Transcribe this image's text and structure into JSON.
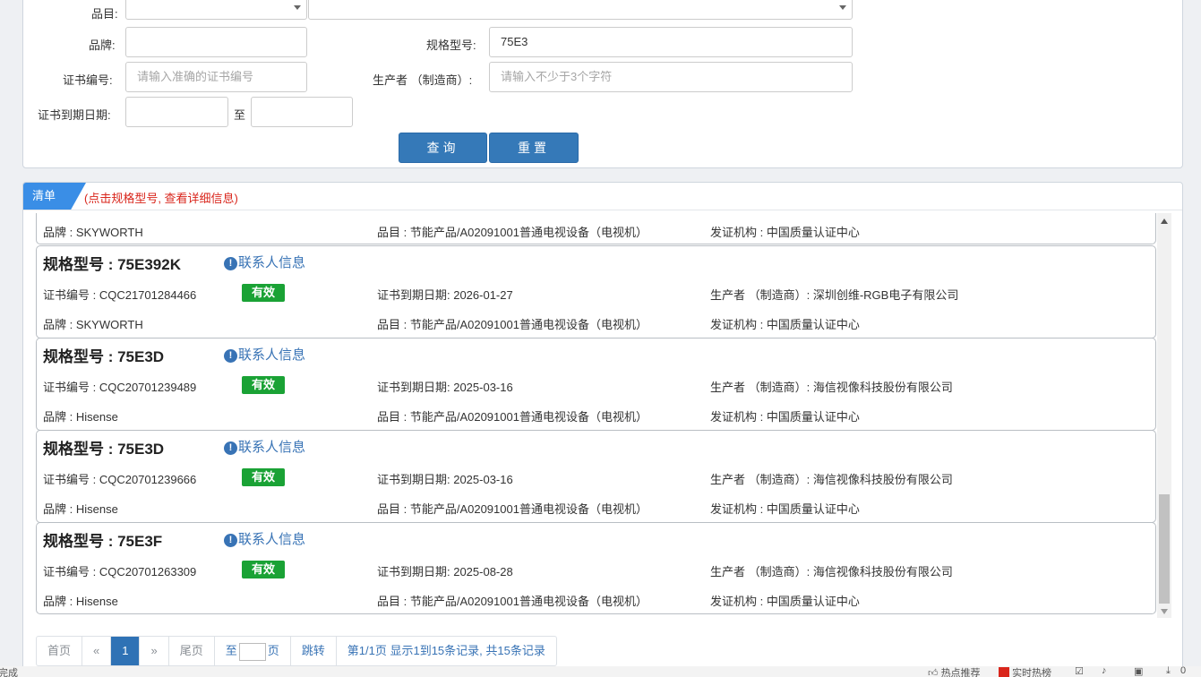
{
  "form": {
    "category_label": "品目:",
    "brand_label": "品牌:",
    "brand_value": "",
    "model_label": "规格型号:",
    "model_value": "75E3",
    "cert_no_label": "证书编号:",
    "cert_no_placeholder": "请输入准确的证书编号",
    "manufacturer_label": "生产者 （制造商）:",
    "manufacturer_placeholder": "请输入不少于3个字符",
    "expiry_label": "证书到期日期:",
    "expiry_to": "至",
    "query_button": "查询",
    "reset_button": "重置"
  },
  "list": {
    "tab_label": "清单",
    "hint": "(点击规格型号, 查看详细信息)",
    "partial_card": {
      "brand": "品牌 : SKYWORTH",
      "category": "品目 : 节能产品/A02091001普通电视设备（电视机）",
      "issuer": "发证机构 : 中国质量认证中心"
    },
    "cards": [
      {
        "title": "规格型号 : 75E392K",
        "contact": "联系人信息",
        "cert_no": "证书编号 : CQC21701284466",
        "status": "有效",
        "expiry": "证书到期日期: 2026-01-27",
        "manufacturer": "生产者 （制造商）: 深圳创维-RGB电子有限公司",
        "brand": "品牌 : SKYWORTH",
        "category": "品目 : 节能产品/A02091001普通电视设备（电视机）",
        "issuer": "发证机构 : 中国质量认证中心"
      },
      {
        "title": "规格型号 : 75E3D",
        "contact": "联系人信息",
        "cert_no": "证书编号 : CQC20701239489",
        "status": "有效",
        "expiry": "证书到期日期: 2025-03-16",
        "manufacturer": "生产者 （制造商）: 海信视像科技股份有限公司",
        "brand": "品牌 : Hisense",
        "category": "品目 : 节能产品/A02091001普通电视设备（电视机）",
        "issuer": "发证机构 : 中国质量认证中心"
      },
      {
        "title": "规格型号 : 75E3D",
        "contact": "联系人信息",
        "cert_no": "证书编号 : CQC20701239666",
        "status": "有效",
        "expiry": "证书到期日期: 2025-03-16",
        "manufacturer": "生产者 （制造商）: 海信视像科技股份有限公司",
        "brand": "品牌 : Hisense",
        "category": "品目 : 节能产品/A02091001普通电视设备（电视机）",
        "issuer": "发证机构 : 中国质量认证中心"
      },
      {
        "title": "规格型号 : 75E3F",
        "contact": "联系人信息",
        "cert_no": "证书编号 : CQC20701263309",
        "status": "有效",
        "expiry": "证书到期日期: 2025-08-28",
        "manufacturer": "生产者 （制造商）: 海信视像科技股份有限公司",
        "brand": "品牌 : Hisense",
        "category": "品目 : 节能产品/A02091001普通电视设备（电视机）",
        "issuer": "发证机构 : 中国质量认证中心"
      }
    ]
  },
  "pager": {
    "first": "首页",
    "prev": "«",
    "current": "1",
    "next": "»",
    "last": "尾页",
    "goto_prefix": "至",
    "goto_suffix": "页",
    "jump": "跳转",
    "summary": "第1/1页  显示1到15条记录, 共15条记录"
  },
  "statusbar": {
    "left": "完成",
    "hot_recommend": "热点推荐",
    "realtime_hot": "实时热榜",
    "count": "0"
  },
  "colors": {
    "primary": "#3579b8",
    "tab": "#3a8ee6",
    "valid_badge": "#1aa235",
    "hint_red": "#d9261c",
    "link": "#3873b5"
  }
}
